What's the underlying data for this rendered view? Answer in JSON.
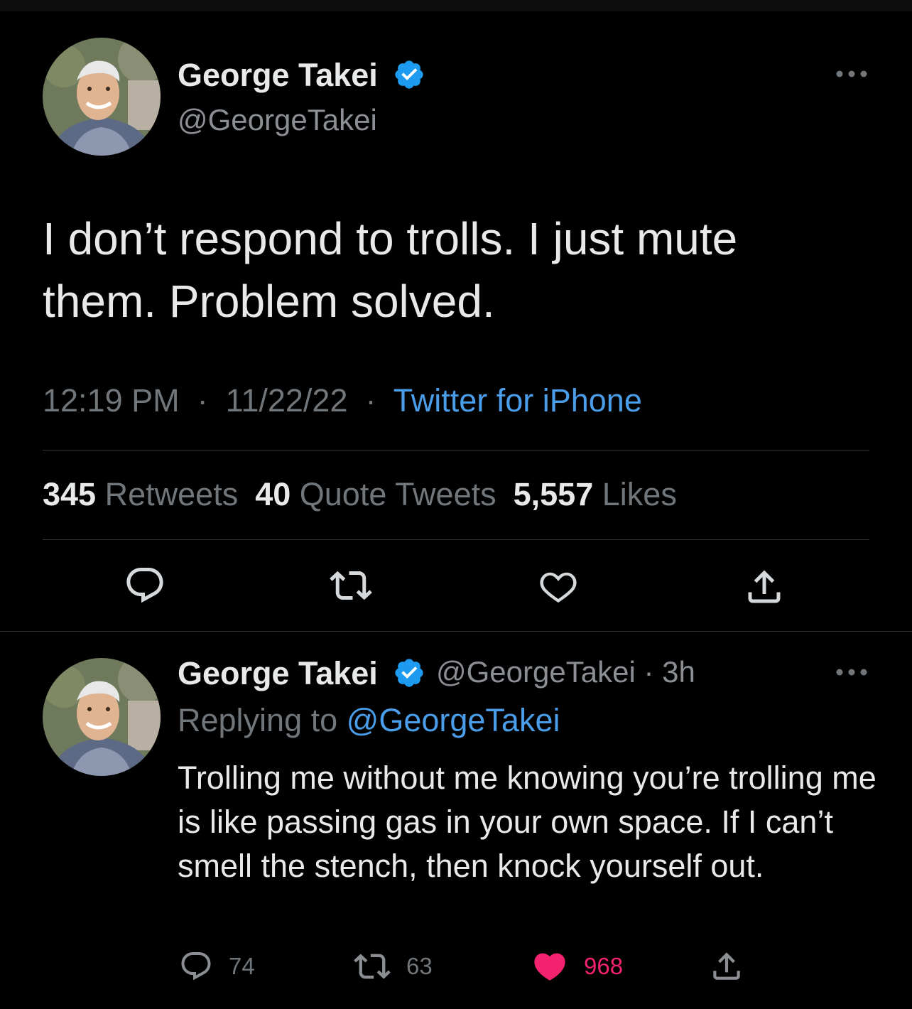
{
  "main_tweet": {
    "display_name": "George Takei",
    "handle": "@GeorgeTakei",
    "text": "I don’t respond to trolls. I just mute them. Problem solved.",
    "time": "12:19 PM",
    "date": "11/22/22",
    "separator": "·",
    "source": "Twitter for iPhone",
    "stats": {
      "retweets_count": "345",
      "retweets_label": "Retweets",
      "quotes_count": "40",
      "quotes_label": "Quote Tweets",
      "likes_count": "5,557",
      "likes_label": "Likes"
    },
    "actions": [
      "reply-icon",
      "retweet-icon",
      "like-icon",
      "share-icon"
    ]
  },
  "reply_tweet": {
    "display_name": "George Takei",
    "handle": "@GeorgeTakei",
    "separator": "·",
    "age": "3h",
    "replying_prefix": "Replying to",
    "replying_to": "@GeorgeTakei",
    "text": "Trolling me without me knowing you’re trolling me is like passing gas in your own space. If I can’t smell the stench, then knock yourself out.",
    "counts": {
      "replies": "74",
      "retweets": "63",
      "likes": "968"
    },
    "liked": true
  },
  "colors": {
    "background": "#000000",
    "primary_text": "#e7e9ea",
    "secondary_text": "#71767b",
    "link": "#4a9de8",
    "verified": "#1d9bf0",
    "like_active": "#f91880"
  }
}
